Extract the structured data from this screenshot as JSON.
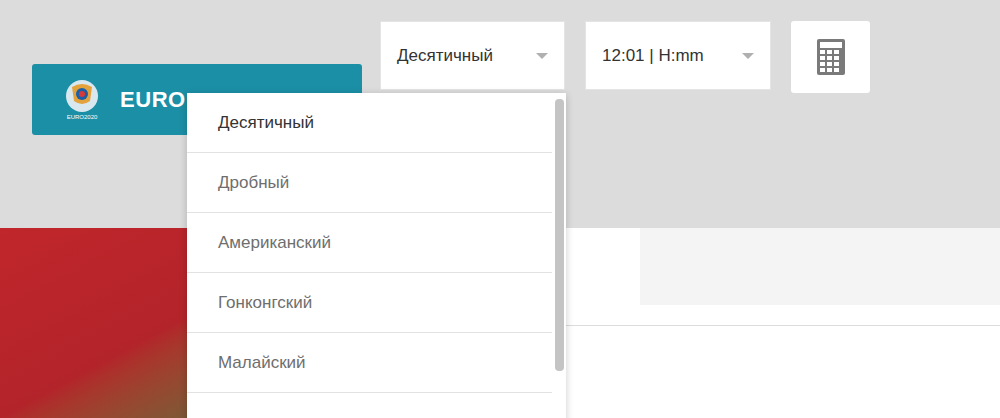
{
  "banner": {
    "logo_caption": "EURO2020",
    "label": "EURO"
  },
  "odds_select": {
    "value": "Десятичный",
    "open": true
  },
  "time_select": {
    "value": "12:01 | H:mm",
    "open": false
  },
  "odds_menu": {
    "items": [
      {
        "label": "Десятичный",
        "selected": true
      },
      {
        "label": "Дробный",
        "selected": false
      },
      {
        "label": "Американский",
        "selected": false
      },
      {
        "label": "Гонконгский",
        "selected": false
      },
      {
        "label": "Малайский",
        "selected": false
      }
    ]
  }
}
